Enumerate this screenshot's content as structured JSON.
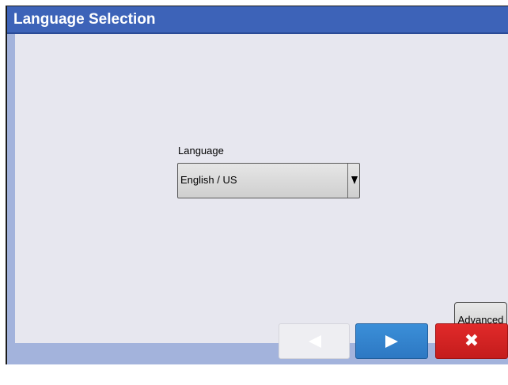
{
  "window": {
    "title": "Language Selection"
  },
  "language_field": {
    "label": "Language",
    "selected_value": "English / US"
  },
  "buttons": {
    "advanced_label": "Advanced",
    "back_icon": "left-triangle-icon",
    "next_icon": "right-triangle-icon",
    "cancel_icon": "close-x-icon",
    "cancel_glyph": "✖"
  },
  "colors": {
    "title_bar": "#3d63b8",
    "content_bg": "#e7e7ef",
    "footer_bg": "#a3b3dc",
    "next_button": "#2d78c3",
    "cancel_button": "#c41c1c",
    "back_button_disabled": "#eeeef2"
  }
}
